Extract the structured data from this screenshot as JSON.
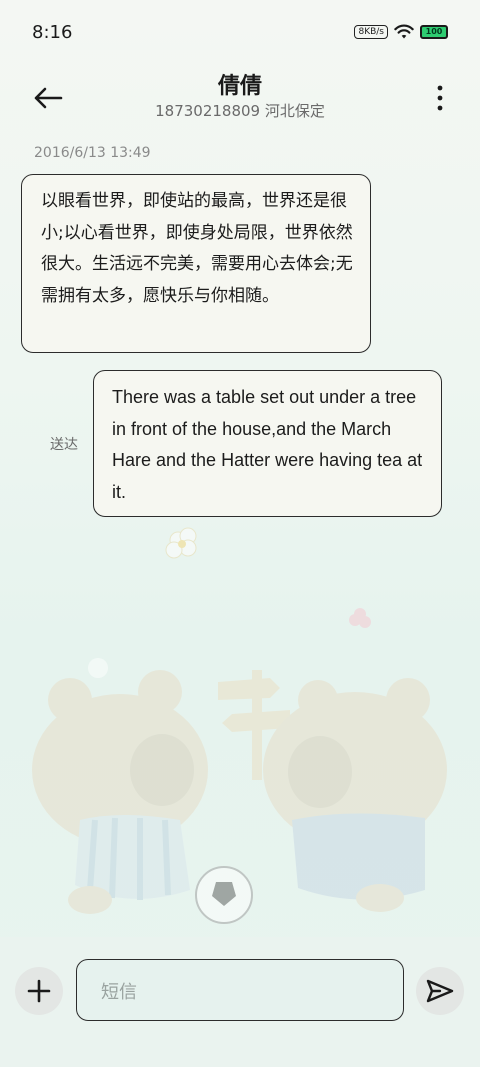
{
  "status_bar": {
    "time": "8:16",
    "speed_badge": "8KB/s",
    "battery_level": "100"
  },
  "header": {
    "contact_name": "倩倩",
    "contact_subtitle": "18730218809 河北保定"
  },
  "conversation": {
    "timestamp": "2016/6/13 13:49",
    "messages": [
      {
        "direction": "incoming",
        "text": "以眼看世界，即使站的最高，世界还是很小;以心看世界，即使身处局限，世界依然很大。生活远不完美，需要用心去体会;无需拥有太多，愿快乐与你相随。"
      },
      {
        "direction": "outgoing",
        "status": "送达",
        "text": "There was a table set out under a tree in front of the house,and the March Hare and the Hatter were having tea at it."
      }
    ]
  },
  "composer": {
    "placeholder": "短信"
  },
  "colors": {
    "background": "#eef6f1",
    "bubble_fill": "#f6f7f1",
    "bubble_border": "#2c2c2c",
    "battery": "#2ecc71"
  },
  "icons": {
    "back": "arrow-left-icon",
    "more": "more-vertical-icon",
    "add": "plus-icon",
    "send": "send-icon"
  }
}
